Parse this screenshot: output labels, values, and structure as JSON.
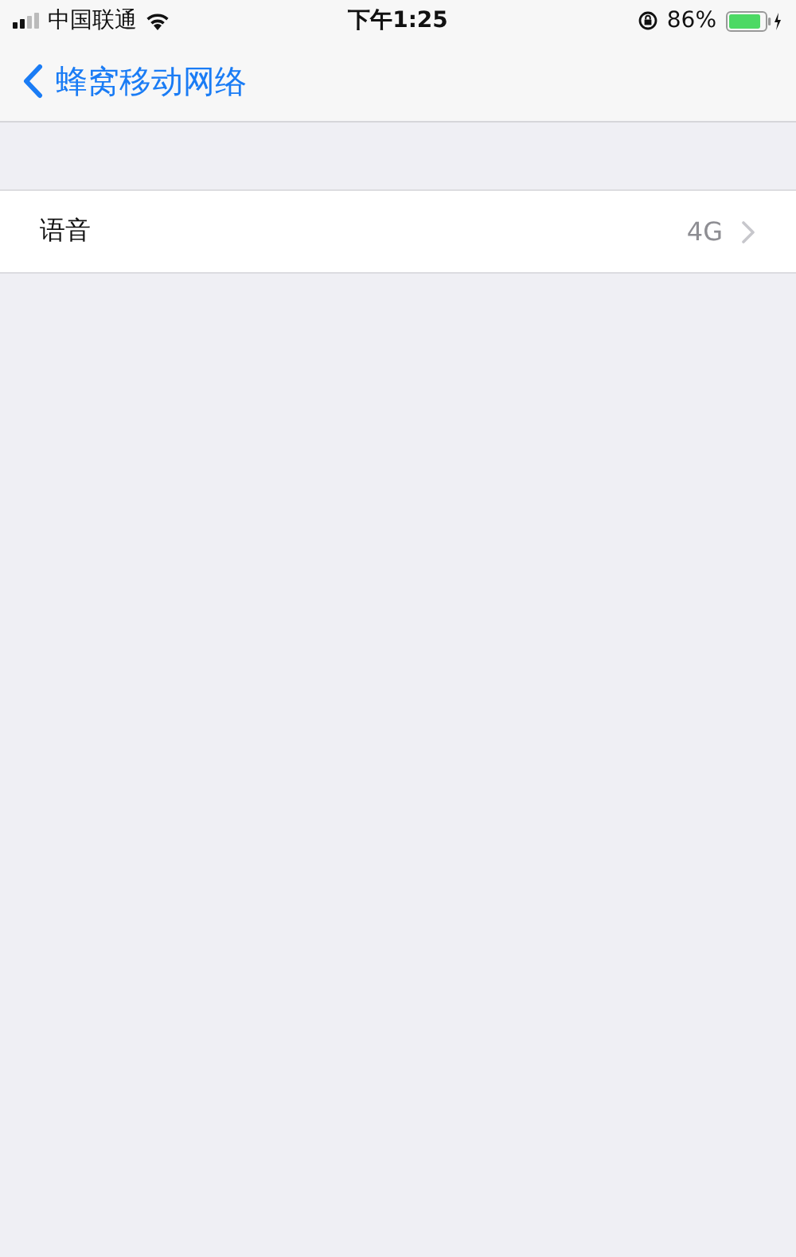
{
  "status_bar": {
    "carrier": "中国联通",
    "time": "下午1:25",
    "battery": "86%"
  },
  "nav_bar": {
    "back_label": "蜂窝移动网络"
  },
  "rows": [
    {
      "kind": "disclosure",
      "label": "语音",
      "value": "4G"
    }
  ]
}
